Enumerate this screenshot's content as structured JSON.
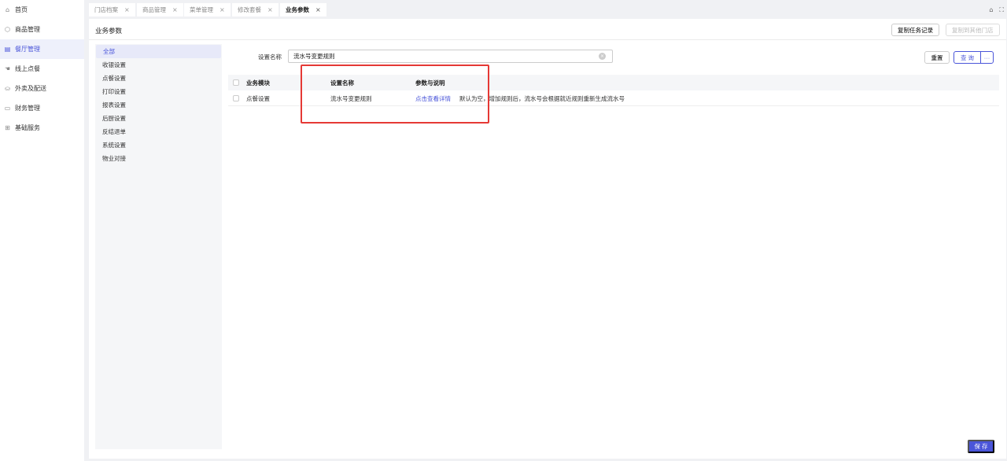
{
  "nav": {
    "items": [
      {
        "label": "首页",
        "icon": "home-icon"
      },
      {
        "label": "商品管理",
        "icon": "cube-icon"
      },
      {
        "label": "餐厅管理",
        "icon": "store-icon",
        "active": true
      },
      {
        "label": "线上点餐",
        "icon": "hand-icon"
      },
      {
        "label": "外卖及配送",
        "icon": "bag-icon"
      },
      {
        "label": "财务管理",
        "icon": "wallet-icon"
      },
      {
        "label": "基础服务",
        "icon": "grid-icon"
      }
    ]
  },
  "tabs": [
    {
      "label": "门店档案",
      "close": "×"
    },
    {
      "label": "商品管理",
      "close": "×"
    },
    {
      "label": "菜单管理",
      "close": "×"
    },
    {
      "label": "修改套餐",
      "close": "×"
    },
    {
      "label": "业务参数",
      "close": "×",
      "active": true
    }
  ],
  "top_icons": {
    "lock": "⌂",
    "fullscreen": "⛶"
  },
  "page": {
    "title": "业务参数",
    "copy_record_label": "复制任务记录",
    "copy_to_store_label": "复制到其他门店"
  },
  "categories": [
    "全部",
    "收银设置",
    "点餐设置",
    "打印设置",
    "报表设置",
    "后厨设置",
    "反结退单",
    "系统设置",
    "物业对接"
  ],
  "filter": {
    "label": "设置名称",
    "value": "流水号变更规则",
    "clear": "×",
    "reset_label": "重置",
    "query_label": "查 询",
    "more_label": "···"
  },
  "table": {
    "headers": {
      "module": "业务模块",
      "name": "设置名称",
      "param": "参数与说明"
    },
    "rows": [
      {
        "module": "点餐设置",
        "name": "流水号变更规则",
        "link": "点击查看详情",
        "description": "默认为空，增加规则后，流水号会根据就近规则重新生成流水号"
      }
    ]
  },
  "save_label": "保 存",
  "colors": {
    "accent": "#4a55d9",
    "highlight": "#e53935"
  }
}
